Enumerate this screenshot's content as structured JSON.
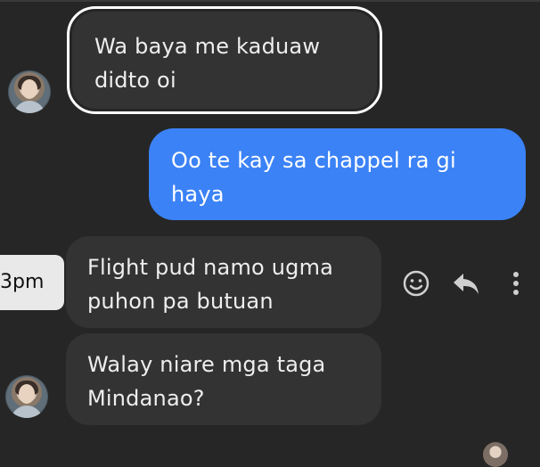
{
  "messages": [
    {
      "id": "m1",
      "direction": "incoming",
      "lines": [
        "Wa baya me kaduaw",
        "didto oi"
      ],
      "highlighted": true
    },
    {
      "id": "m2",
      "direction": "outgoing",
      "lines": [
        "Oo te kay sa chappel ra gi",
        "haya"
      ]
    },
    {
      "id": "m3",
      "direction": "incoming",
      "lines": [
        "Flight pud namo ugma",
        "puhon pa butuan"
      ]
    },
    {
      "id": "m4",
      "direction": "incoming",
      "lines": [
        "Walay niare mga taga",
        "Mindanao?"
      ]
    }
  ],
  "tooltip": {
    "time_text": "3pm"
  },
  "actions": {
    "react_icon": "smiley-icon",
    "reply_icon": "reply-icon",
    "more_icon": "more-vertical-icon"
  },
  "colors": {
    "background": "#262626",
    "incoming_bubble": "#333333",
    "outgoing_bubble": "#3b82f6",
    "tooltip_bg": "#e9e9e9"
  }
}
